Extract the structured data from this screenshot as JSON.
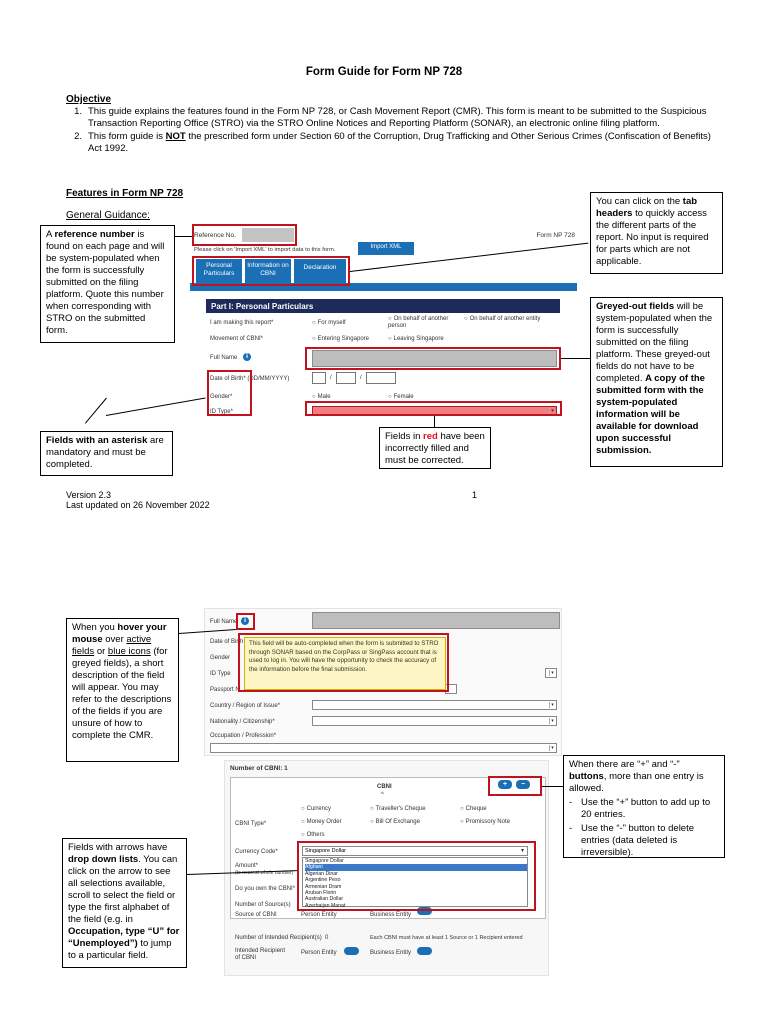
{
  "title": "Form Guide for Form NP 728",
  "objective": {
    "heading": "Objective",
    "items": [
      {
        "num": "1.",
        "text": "This guide explains the features found in the Form NP 728, or Cash Movement Report (CMR). This form is meant to be submitted to the Suspicious Transaction Reporting Office (STRO) via the STRO Online Notices and Reporting Platform (SONAR), an electronic online filing platform."
      },
      {
        "num": "2.",
        "pre": "This form guide is ",
        "bold": "NOT",
        "post": " the prescribed form under Section 60 of the Corruption, Drug Trafficking and Other Serious Crimes (Confiscation of Benefits) Act 1992."
      }
    ]
  },
  "features_heading": "Features in Form NP 728",
  "general_guidance": "General Guidance:",
  "callouts": {
    "reference": {
      "pre": "A ",
      "bold": "reference number",
      "post": " is found on each page and will be system-populated when the form is successfully submitted on the filing platform. Quote this number when corresponding with STRO on the submitted form."
    },
    "tabs": {
      "pre": "You can click on the ",
      "bold": "tab headers",
      "post": " to quickly access the different parts of the report. No input is required for parts which are not applicable."
    },
    "greyed": {
      "bold1": "Greyed-out fields",
      "mid": " will be system-populated when the form is successfully submitted on the filing platform. These greyed-out fields do not have to be completed. ",
      "bold2": "A copy of the submitted form with the system-populated information will be available for download upon successful submission."
    },
    "asterisk": {
      "bold": "Fields with an asterisk",
      "post": " are mandatory and must be completed."
    },
    "red": {
      "pre": "Fields in ",
      "red": "red",
      "post": " have been incorrectly filled and must be corrected."
    },
    "hover": {
      "pre": "When you ",
      "bold1": "hover your mouse",
      "mid1": " over ",
      "u1": "active fields",
      "mid2": " or ",
      "u2": "blue icons",
      "post": " (for greyed fields), a short description of the field will appear. You may refer to the descriptions of the fields if you are unsure of how to complete the CMR."
    },
    "plusminus": {
      "pre": "When there are “+” and “-” ",
      "bold": "buttons",
      "post": ", more than one entry is allowed.",
      "b1_pre": "Use the “+” button to add up to 20 entries.",
      "b2_pre": "Use the “-” button to delete entries (data deleted is irreversible)."
    },
    "dropdown": {
      "pre": "Fields with arrows have ",
      "bold": "drop down lists",
      "mid": ". You can click on the arrow to see all selections available, scroll to select the field or type the first alphabet of the field (e.g. in ",
      "b1": "Occupation, type “U” for “Unemployed”)",
      "post": " to jump to a particular field."
    }
  },
  "footer": {
    "version": "Version 2.3",
    "updated": "Last updated on 26 November 2022",
    "page": "1"
  },
  "shot1": {
    "ref_label": "Reference No.",
    "form_label": "Form NP 728",
    "import_hint": "Please click on 'Import XML' to import data to this form.",
    "import_btn": "Import XML",
    "tabs": [
      "Personal Particulars",
      "Information on CBNI",
      "Declaration"
    ],
    "section_title": "Part I: Personal Particulars",
    "making_label": "I am making this report*",
    "making_opts": [
      "For myself",
      "On behalf of another person",
      "On behalf of another entity"
    ],
    "movement_label": "Movement of CBNI*",
    "movement_opts": [
      "Entering Singapore",
      "Leaving Singapore"
    ],
    "fullname_label": "Full Name",
    "dob_label": "Date of Birth* (DD/MM/YYYY)",
    "gender_label": "Gender*",
    "gender_opts": [
      "Male",
      "Female"
    ],
    "idtype_label": "ID Type*",
    "info_icon": "i"
  },
  "shot2": {
    "fullname_label": "Full Name",
    "dob_label": "Date of Birth",
    "gender_label": "Gender",
    "idtype_label": "ID Type",
    "passport_label": "Passport N",
    "country_label": "Country / Region of Issue*",
    "nationality_label": "Nationality / Citizenship*",
    "occupation_label": "Occupation / Profession*",
    "tooltip": "This field will be auto-completed when the form is submitted to STRO through SONAR based on the CorpPass or SingPass account that is used to log in. You will have the opportunity to check the accuracy of the information before the final submission.",
    "info_icon": "i"
  },
  "shot3": {
    "number_label": "Number of CBNI: 1",
    "cbni_header": "CBNI",
    "plus": "+",
    "minus": "−",
    "type_label": "CBNI Type*",
    "type_opts": [
      "Currency",
      "Traveller's Cheque",
      "Cheque",
      "Money Order",
      "Bill Of Exchange",
      "Promissory Note",
      "Others"
    ],
    "currency_label": "Currency Code*",
    "currency_value": "Singapore Dollar",
    "amount_label": "Amount*",
    "amount_sub": "(to nearest whole number)",
    "own_label": "Do you own the CBNI*",
    "sources_label": "Number of Source(s)",
    "source_label": "Source of CBNI",
    "source_opts": [
      "Person Entity",
      "Business Entity"
    ],
    "dropdown_items": [
      "Singapore Dollar",
      "Afghani",
      "Algerian Dinar",
      "Argentine Peso",
      "Armenian Dram",
      "Aruban Florin",
      "Australian Dollar",
      "Azerbaijan Manat"
    ],
    "recipients_label": "Number of Intended Recipient(s)",
    "recipients_value": "0",
    "recipients_note": "Each CBNI must have at least 1 Source or 1 Recipient entered",
    "intended_label": "Intended Recipient of CBNI",
    "intended_opts": [
      "Person Entity",
      "Business Entity"
    ]
  }
}
